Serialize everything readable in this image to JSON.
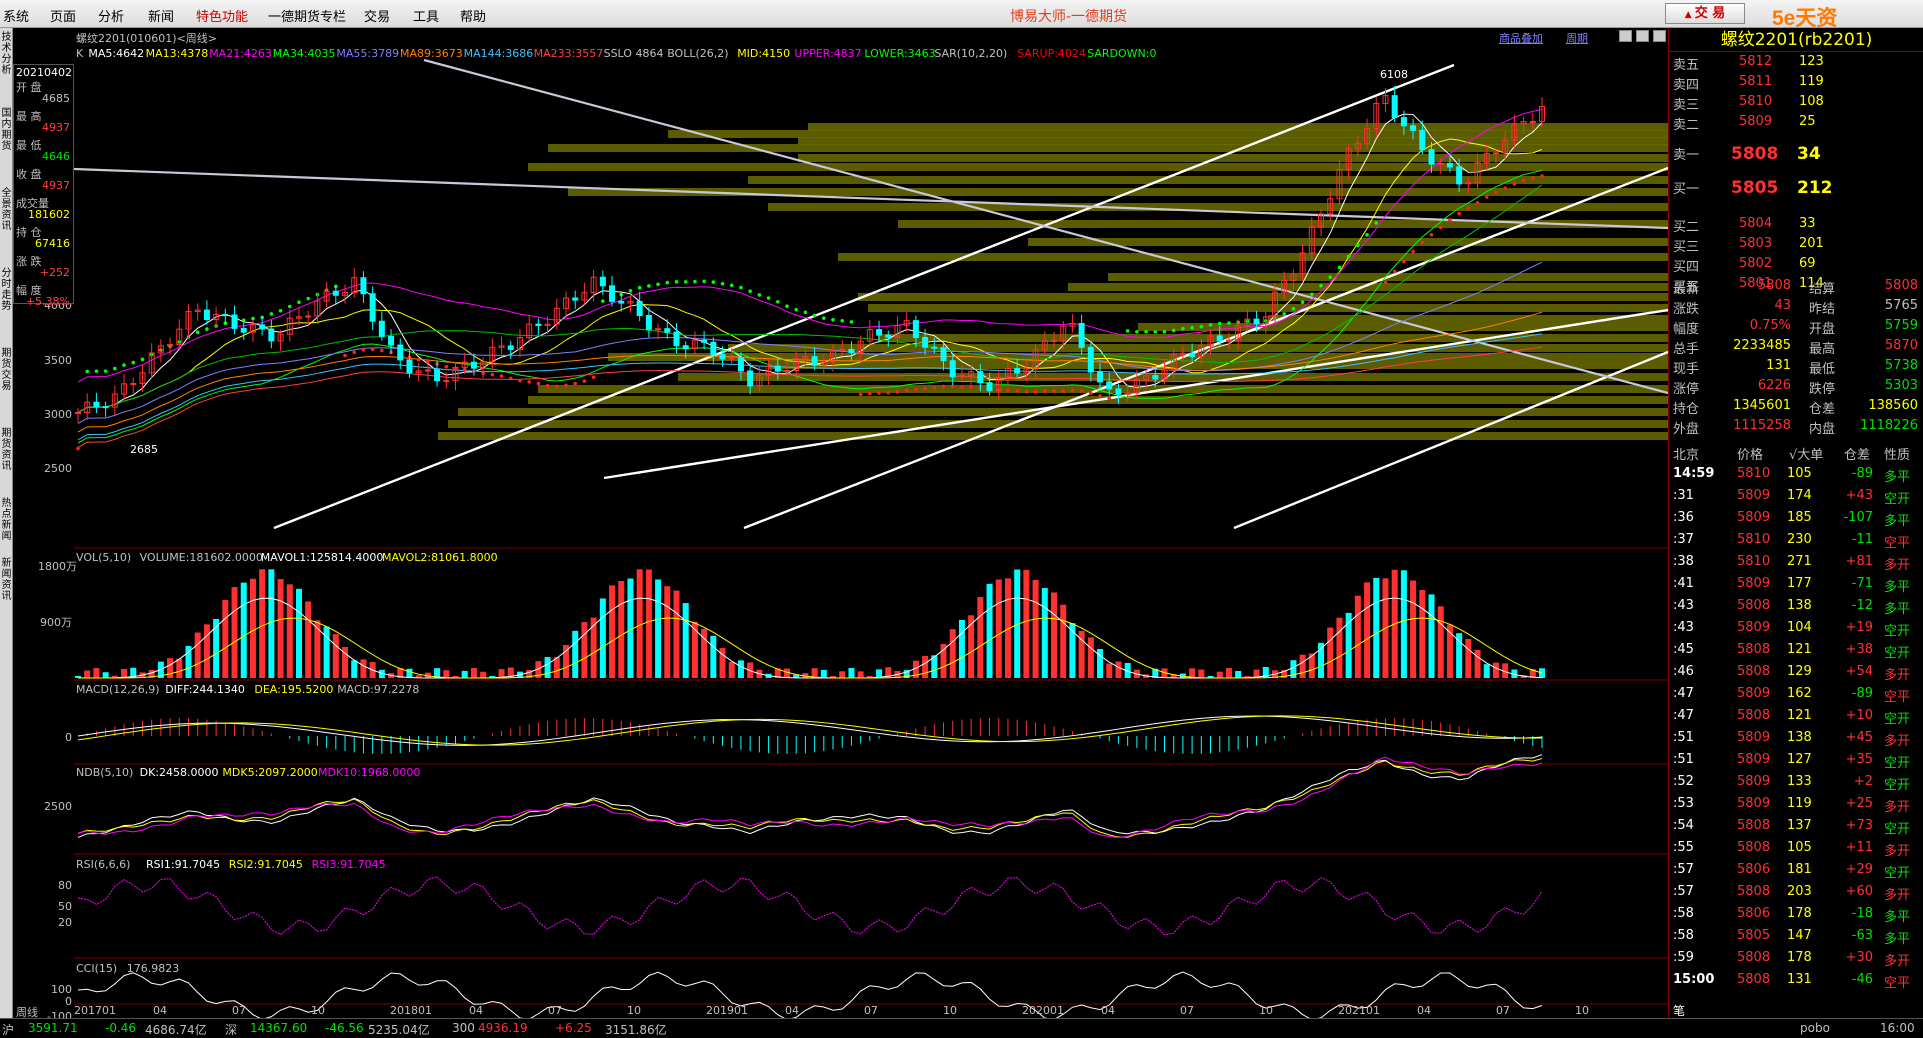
{
  "menu": {
    "items": [
      "系统",
      "页面",
      "分析",
      "新闻",
      "特色功能",
      "一德期货专栏",
      "交易",
      "工具",
      "帮助"
    ],
    "app_title": "博易大师-一德期货",
    "trade_button": "交 易",
    "watermark": "5e天资5etz.com"
  },
  "leftbar": [
    "技术分析",
    "国内期货",
    "全景资讯",
    "分时走势",
    "期货交易",
    "期货资讯",
    "热点新闻",
    "新闻资讯"
  ],
  "chart_header": {
    "symbol": "螺纹2201(010601)<周线>",
    "links": [
      "商品叠加",
      "周期"
    ]
  },
  "ma_line": [
    {
      "t": "K",
      "c": "#c0c0c0"
    },
    {
      "t": "MA5:4642",
      "c": "#ffffff"
    },
    {
      "t": "MA13:4378",
      "c": "#ffff00"
    },
    {
      "t": "MA21:4263",
      "c": "#ff00ff"
    },
    {
      "t": "MA34:4035",
      "c": "#00ff00"
    },
    {
      "t": "MA55:3789",
      "c": "#8080ff"
    },
    {
      "t": "MA89:3673",
      "c": "#ff8000"
    },
    {
      "t": "MA144:3686",
      "c": "#40c0ff"
    },
    {
      "t": "MA233:3557",
      "c": "#ff4040"
    },
    {
      "t": "SSLO 4864",
      "c": "#c0c0c0"
    },
    {
      "t": "BOLL(26,2)",
      "c": "#c0c0c0"
    },
    {
      "t": "MID:4150",
      "c": "#ffff00"
    },
    {
      "t": "UPPER:4837",
      "c": "#ff00ff"
    },
    {
      "t": "LOWER:3463",
      "c": "#00ff00"
    },
    {
      "t": "SAR(10,2,20)",
      "c": "#c0c0c0"
    },
    {
      "t": "SARUP:4024",
      "c": "#ff0000"
    },
    {
      "t": "SARDOWN:0",
      "c": "#00ff00"
    }
  ],
  "info_panel": {
    "date": "20210402",
    "rows": [
      {
        "label": "开 盘",
        "value": "4685",
        "color": "#c0c0c0"
      },
      {
        "label": "最 高",
        "value": "4937",
        "color": "#ff4040"
      },
      {
        "label": "最 低",
        "value": "4646",
        "color": "#00e000"
      },
      {
        "label": "收 盘",
        "value": "4937",
        "color": "#ff4040"
      },
      {
        "label": "成交量",
        "value": "181602",
        "color": "#ffff00"
      },
      {
        "label": "持 仓",
        "value": "67416",
        "color": "#ffff00"
      },
      {
        "label": "涨 跌",
        "value": "+252",
        "color": "#ff4040"
      },
      {
        "label": "幅 度",
        "value": "+5.38%",
        "color": "#ff4040"
      }
    ]
  },
  "price_axis": [
    "4000",
    "3500",
    "3000",
    "2500"
  ],
  "price_marks": {
    "high": "6108",
    "low": "2685"
  },
  "indicators": {
    "vol": {
      "title": "VOL(5,10)",
      "items": [
        {
          "t": "VOLUME:181602.0000",
          "c": "#c0c0c0"
        },
        {
          "t": "MAVOL1:125814.4000",
          "c": "#ffffff"
        },
        {
          "t": "MAVOL2:81061.8000",
          "c": "#ffff00"
        }
      ],
      "axis": [
        "1800万",
        "900万"
      ]
    },
    "macd": {
      "title": "MACD(12,26,9)",
      "items": [
        {
          "t": "DIFF:244.1340",
          "c": "#ffffff"
        },
        {
          "t": "DEA:195.5200",
          "c": "#ffff00"
        },
        {
          "t": "MACD:97.2278",
          "c": "#c0c0c0"
        }
      ],
      "axis": [
        "0"
      ]
    },
    "ndb": {
      "title": "NDB(5,10)",
      "items": [
        {
          "t": "DK:2458.0000",
          "c": "#ffffff"
        },
        {
          "t": "MDK5:2097.2000",
          "c": "#ffff00"
        },
        {
          "t": "MDK10:1968.0000",
          "c": "#ff00ff"
        }
      ],
      "axis": [
        "2500"
      ]
    },
    "rsi": {
      "title": "RSI(6,6,6)",
      "items": [
        {
          "t": "RSI1:91.7045",
          "c": "#ffffff"
        },
        {
          "t": "RSI2:91.7045",
          "c": "#ffff00"
        },
        {
          "t": "RSI3:91.7045",
          "c": "#ff00ff"
        }
      ],
      "axis": [
        "80",
        "50",
        "20"
      ]
    },
    "cci": {
      "title": "CCI(15)",
      "items": [
        {
          "t": "176.9823",
          "c": "#c0c0c0"
        }
      ],
      "axis": [
        "100",
        "0",
        "-100"
      ]
    }
  },
  "x_axis": {
    "label": "周线",
    "ticks": [
      "201701",
      "04",
      "07",
      "10",
      "201801",
      "04",
      "07",
      "10",
      "201901",
      "04",
      "07",
      "10",
      "202001",
      "04",
      "07",
      "10",
      "202101",
      "04",
      "07",
      "10"
    ]
  },
  "quote": {
    "title": "螺纹2201(rb2201)",
    "asks": [
      {
        "l": "卖五",
        "p": "5812",
        "v": "123"
      },
      {
        "l": "卖四",
        "p": "5811",
        "v": "119"
      },
      {
        "l": "卖三",
        "p": "5810",
        "v": "108"
      },
      {
        "l": "卖二",
        "p": "5809",
        "v": "25"
      },
      {
        "l": "卖一",
        "p": "5808",
        "v": "34"
      }
    ],
    "bids": [
      {
        "l": "买一",
        "p": "5805",
        "v": "212"
      },
      {
        "l": "买二",
        "p": "5804",
        "v": "33"
      },
      {
        "l": "买三",
        "p": "5803",
        "v": "201"
      },
      {
        "l": "买四",
        "p": "5802",
        "v": "69"
      },
      {
        "l": "买五",
        "p": "5801",
        "v": "114"
      }
    ],
    "stats": [
      {
        "l1": "最新",
        "v1": "5808",
        "c1": "#ff3030",
        "l2": "结算",
        "v2": "5808",
        "c2": "#ff3030"
      },
      {
        "l1": "涨跌",
        "v1": "43",
        "c1": "#ff3030",
        "l2": "昨结",
        "v2": "5765",
        "c2": "#c0c0c0"
      },
      {
        "l1": "幅度",
        "v1": "0.75%",
        "c1": "#ff3030",
        "l2": "开盘",
        "v2": "5759",
        "c2": "#00e000"
      },
      {
        "l1": "总手",
        "v1": "2233485",
        "c1": "#ffff00",
        "l2": "最高",
        "v2": "5870",
        "c2": "#ff3030"
      },
      {
        "l1": "现手",
        "v1": "131",
        "c1": "#ffff00",
        "l2": "最低",
        "v2": "5738",
        "c2": "#00e000"
      },
      {
        "l1": "涨停",
        "v1": "6226",
        "c1": "#ff3030",
        "l2": "跌停",
        "v2": "5303",
        "c2": "#00e000"
      },
      {
        "l1": "持仓",
        "v1": "1345601",
        "c1": "#ffff00",
        "l2": "仓差",
        "v2": "138560",
        "c2": "#ffff00"
      },
      {
        "l1": "外盘",
        "v1": "1115258",
        "c1": "#ff3030",
        "l2": "内盘",
        "v2": "1118226",
        "c2": "#00e000"
      }
    ],
    "tick_header": [
      "北京",
      "价格",
      "√大单",
      "仓差",
      "性质"
    ],
    "ticks": [
      {
        "t": "14:59",
        "p": "5810",
        "v": "105",
        "d": "-89",
        "n": "多平"
      },
      {
        "t": ":31",
        "p": "5809",
        "v": "174",
        "d": "+43",
        "n": "空开"
      },
      {
        "t": ":36",
        "p": "5809",
        "v": "185",
        "d": "-107",
        "n": "多平"
      },
      {
        "t": ":37",
        "p": "5810",
        "v": "230",
        "d": "-11",
        "n": "空平"
      },
      {
        "t": ":38",
        "p": "5810",
        "v": "271",
        "d": "+81",
        "n": "多开"
      },
      {
        "t": ":41",
        "p": "5809",
        "v": "177",
        "d": "-71",
        "n": "多平"
      },
      {
        "t": ":43",
        "p": "5808",
        "v": "138",
        "d": "-12",
        "n": "多平"
      },
      {
        "t": ":43",
        "p": "5809",
        "v": "104",
        "d": "+19",
        "n": "空开"
      },
      {
        "t": ":45",
        "p": "5808",
        "v": "121",
        "d": "+38",
        "n": "空开"
      },
      {
        "t": ":46",
        "p": "5808",
        "v": "129",
        "d": "+54",
        "n": "多开"
      },
      {
        "t": ":47",
        "p": "5809",
        "v": "162",
        "d": "-89",
        "n": "空平"
      },
      {
        "t": ":47",
        "p": "5808",
        "v": "121",
        "d": "+10",
        "n": "空开"
      },
      {
        "t": ":51",
        "p": "5809",
        "v": "138",
        "d": "+45",
        "n": "多开"
      },
      {
        "t": ":51",
        "p": "5809",
        "v": "127",
        "d": "+35",
        "n": "空开"
      },
      {
        "t": ":52",
        "p": "5809",
        "v": "133",
        "d": "+2",
        "n": "空开"
      },
      {
        "t": ":53",
        "p": "5809",
        "v": "119",
        "d": "+25",
        "n": "多开"
      },
      {
        "t": ":54",
        "p": "5808",
        "v": "137",
        "d": "+73",
        "n": "空开"
      },
      {
        "t": ":55",
        "p": "5808",
        "v": "105",
        "d": "+11",
        "n": "多开"
      },
      {
        "t": ":57",
        "p": "5806",
        "v": "181",
        "d": "+29",
        "n": "空开"
      },
      {
        "t": ":57",
        "p": "5808",
        "v": "203",
        "d": "+60",
        "n": "多开"
      },
      {
        "t": ":58",
        "p": "5806",
        "v": "178",
        "d": "-18",
        "n": "多平"
      },
      {
        "t": ":58",
        "p": "5805",
        "v": "147",
        "d": "-63",
        "n": "多平"
      },
      {
        "t": ":59",
        "p": "5808",
        "v": "178",
        "d": "+30",
        "n": "多开"
      },
      {
        "t": "15:00",
        "p": "5808",
        "v": "131",
        "d": "-46",
        "n": "空平"
      }
    ],
    "bottom_tab": "笔"
  },
  "bottom_bar": [
    {
      "t": "沪",
      "c": "#c0c0c0"
    },
    {
      "t": "3591.71",
      "c": "#00e000"
    },
    {
      "t": "-0.46",
      "c": "#00e000"
    },
    {
      "t": "4686.74亿",
      "c": "#c0c0c0"
    },
    {
      "t": "深",
      "c": "#c0c0c0"
    },
    {
      "t": "14367.60",
      "c": "#00e000"
    },
    {
      "t": "-46.56",
      "c": "#00e000"
    },
    {
      "t": "5235.04亿",
      "c": "#c0c0c0"
    },
    {
      "t": "300",
      "c": "#c0c0c0"
    },
    {
      "t": "4936.19",
      "c": "#ff3030"
    },
    {
      "t": "+6.25",
      "c": "#ff3030"
    },
    {
      "t": "3151.86亿",
      "c": "#c0c0c0"
    },
    {
      "t": "pobo",
      "c": "#c0c0c0"
    },
    {
      "t": "16:00",
      "c": "#c0c0c0"
    }
  ],
  "chart_data": {
    "type": "line",
    "title": "螺纹2201(010601)<周线>",
    "x_ticks": [
      "201701",
      "201801",
      "201901",
      "202001",
      "202101"
    ],
    "y_ticks": [
      2500,
      3000,
      3500,
      4000
    ],
    "high": 6108,
    "low": 2685,
    "close": [
      3000,
      3150,
      3550,
      3950,
      3800,
      3700,
      4000,
      4200,
      3500,
      3300,
      3450,
      3650,
      3900,
      4200,
      3950,
      3650,
      3600,
      3300,
      3450,
      3500,
      3700,
      3800,
      3400,
      3250,
      3450,
      3850,
      3150,
      3300,
      3550,
      3700,
      3900,
      4500,
      5300,
      5900,
      5400,
      5100,
      5500,
      5800
    ]
  }
}
